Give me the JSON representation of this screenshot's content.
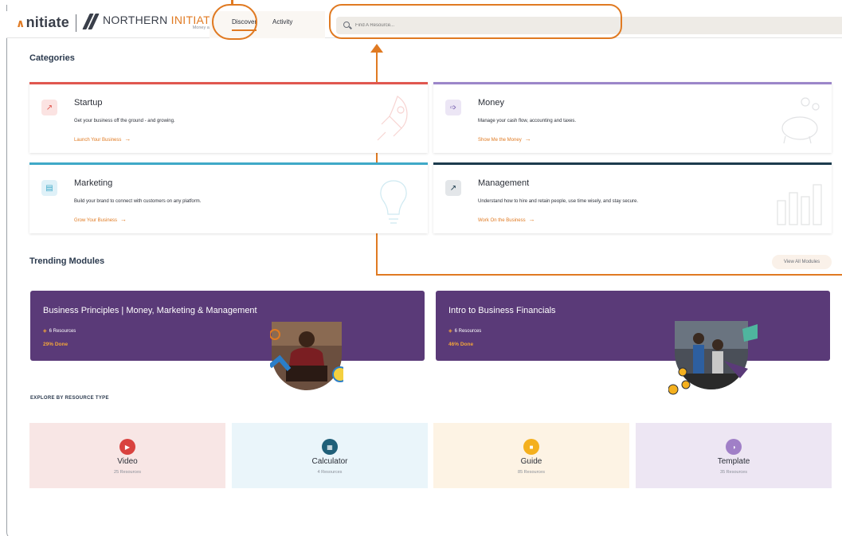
{
  "header": {
    "logo_prefix": "∧",
    "logo_text": "nitiate",
    "partner_name_a": "NORTHERN ",
    "partner_name_b": "INITIATIVES",
    "partner_tagline": "Money and Know-How",
    "nav": [
      {
        "label": "Discover",
        "active": true
      },
      {
        "label": "Activity",
        "active": false
      }
    ],
    "search": {
      "placeholder": "Find A Resource..."
    }
  },
  "categories": {
    "title": "Categories",
    "items": [
      {
        "name": "Startup",
        "description": "Get your business off the ground - and growing.",
        "link": "Launch Your Business",
        "color": "#e0574f",
        "icon": "rocket-icon",
        "icon_glyph": "↗",
        "icon_bg": "#fbe3e2"
      },
      {
        "name": "Money",
        "description": "Manage your cash flow, accounting and taxes.",
        "link": "Show Me the Money",
        "color": "#9b86c9",
        "icon": "money-hand-icon",
        "icon_glyph": "➩",
        "icon_bg": "#ece6f5"
      },
      {
        "name": "Marketing",
        "description": "Build your brand to connect with customers on any platform.",
        "link": "Grow Your Business",
        "color": "#3fa9c8",
        "icon": "store-icon",
        "icon_glyph": "▤",
        "icon_bg": "#dff1f8"
      },
      {
        "name": "Management",
        "description": "Understand how to hire and retain people, use time wisely, and stay secure.",
        "link": "Work On the Business",
        "color": "#1c3b4d",
        "icon": "chart-icon",
        "icon_glyph": "↗",
        "icon_bg": "#e3e6e9"
      }
    ]
  },
  "trending": {
    "title": "Trending Modules",
    "view_all": "View All Modules",
    "modules": [
      {
        "title": "Business Principles | Money, Marketing & Management",
        "resources": "6 Resources",
        "progress": "29% Done"
      },
      {
        "title": "Intro to Business Financials",
        "resources": "6 Resources",
        "progress": "46% Done"
      }
    ]
  },
  "explore": {
    "title": "EXPLORE BY RESOURCE TYPE",
    "types": [
      {
        "name": "Video",
        "count": "25 Resources",
        "icon": "video-icon",
        "glyph": "▶",
        "color": "#d9423f",
        "bg": "#f8e6e5"
      },
      {
        "name": "Calculator",
        "count": "4 Resources",
        "icon": "calculator-icon",
        "glyph": "▦",
        "color": "#1f5f78",
        "bg": "#eaf5fa"
      },
      {
        "name": "Guide",
        "count": "85 Resources",
        "icon": "guide-icon",
        "glyph": "■",
        "color": "#f4b01e",
        "bg": "#fdf3e4"
      },
      {
        "name": "Template",
        "count": "35 Resources",
        "icon": "template-icon",
        "glyph": "◑",
        "color": "#a07fc7",
        "bg": "#ede6f3"
      }
    ]
  },
  "colors": {
    "accent": "#e07a22",
    "module_bg": "#5a3a78",
    "heading": "#2b3a4e"
  }
}
